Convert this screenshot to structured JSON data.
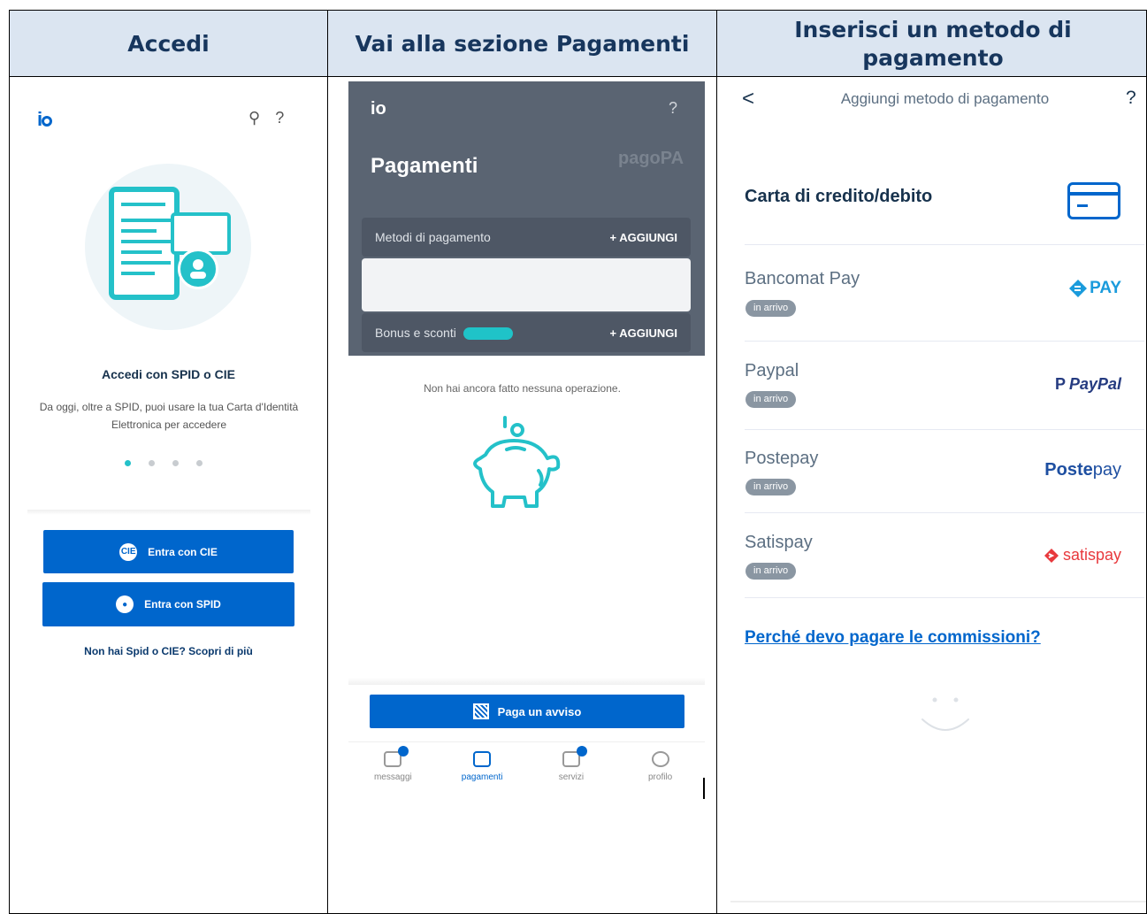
{
  "headers": {
    "col1": "Accedi",
    "col2": "Vai alla sezione Pagamenti",
    "col3": "Inserisci un metodo di pagamento"
  },
  "panel1": {
    "logo_text": "io",
    "search_icon": "search-icon",
    "help_icon": "help-icon",
    "title": "Accedi con SPID o CIE",
    "description": "Da oggi, oltre a SPID, puoi usare la tua Carta d'Identità Elettronica per accedere",
    "cie_button": "Entra con CIE",
    "cie_button_icon_text": "CIE",
    "spid_button": "Entra con SPID",
    "link": "Non hai Spid o CIE? Scopri di più",
    "colors": {
      "primary": "#0066cc",
      "accent": "#24c1c9"
    }
  },
  "panel2": {
    "logo_text": "io",
    "help": "?",
    "title": "Pagamenti",
    "brand": "pagoPA",
    "methods_label": "Metodi di pagamento",
    "methods_add": "+ AGGIUNGI",
    "bonus_label": "Bonus e sconti",
    "bonus_add": "+ AGGIUNGI",
    "empty_text": "Non hai ancora fatto nessuna operazione.",
    "pay_button": "Paga un avviso",
    "tabs": [
      {
        "label": "messaggi",
        "icon": "messages-icon"
      },
      {
        "label": "pagamenti",
        "icon": "wallet-icon"
      },
      {
        "label": "servizi",
        "icon": "services-icon"
      },
      {
        "label": "profilo",
        "icon": "profile-icon"
      }
    ]
  },
  "panel3": {
    "back": "<",
    "title": "Aggiungi metodo di pagamento",
    "help": "?",
    "methods": [
      {
        "name": "Carta di credito/debito",
        "badge": "",
        "logo": ""
      },
      {
        "name": "Bancomat Pay",
        "badge": "in arrivo",
        "logo": "PAY"
      },
      {
        "name": "Paypal",
        "badge": "in arrivo",
        "logo": "PayPal"
      },
      {
        "name": "Postepay",
        "badge": "in arrivo",
        "logo_bold": "Poste",
        "logo_light": "pay"
      },
      {
        "name": "Satispay",
        "badge": "in arrivo",
        "logo": "satispay"
      }
    ],
    "link": "Perché devo pagare le commissioni?"
  }
}
